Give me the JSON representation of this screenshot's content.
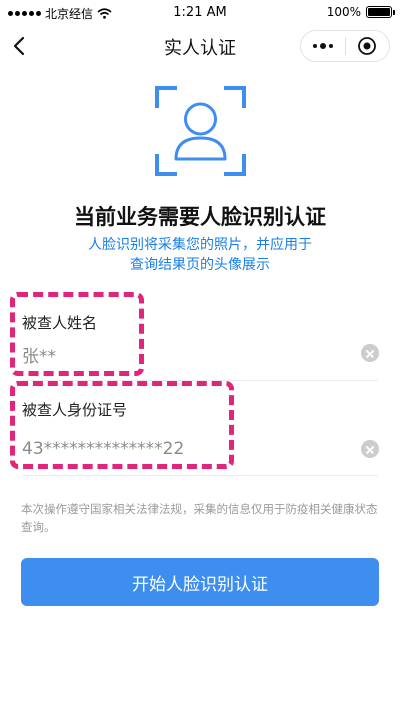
{
  "status_bar": {
    "carrier": "北京经信",
    "time": "1:21 AM",
    "battery": "100%"
  },
  "nav": {
    "title": "实人认证"
  },
  "main": {
    "headline": "当前业务需要人脸识别认证",
    "sub_line1": "人脸识别将采集您的照片，并应用于",
    "sub_line2": "查询结果页的头像展示"
  },
  "form": {
    "name_label": "被查人姓名",
    "name_value": "张**",
    "id_label": "被查人身份证号",
    "id_value": "43**************22"
  },
  "notice": {
    "text": "本次操作遵守国家相关法律法规，采集的信息仅用于防疫相关健康状态查询。"
  },
  "actions": {
    "start_button": "开始人脸识别认证"
  },
  "colors": {
    "accent": "#3e8ef0",
    "subtext": "#1b7fe6",
    "annotation": "#e0257a"
  }
}
